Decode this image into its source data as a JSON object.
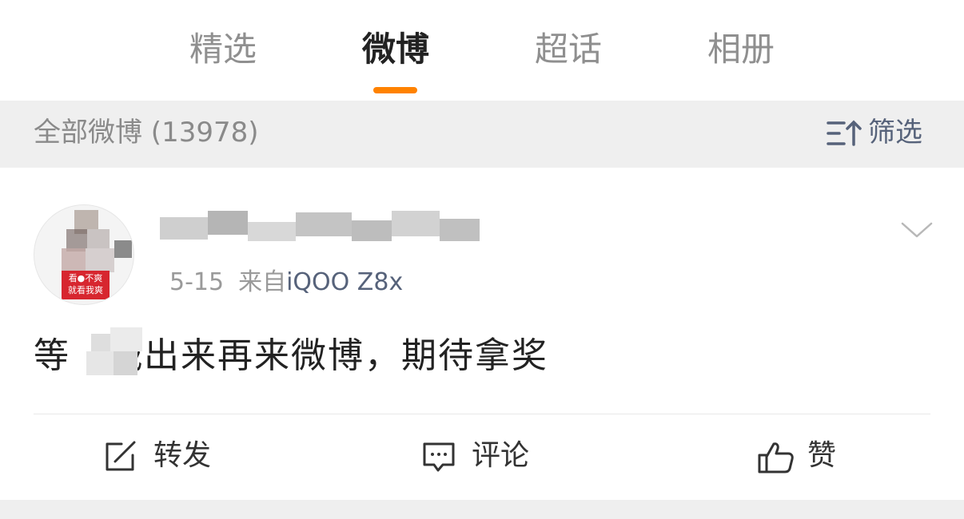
{
  "tabs": [
    {
      "label": "精选",
      "active": false
    },
    {
      "label": "微博",
      "active": true
    },
    {
      "label": "超话",
      "active": false
    },
    {
      "label": "相册",
      "active": false
    }
  ],
  "filter_bar": {
    "title": "全部微博 (13978)",
    "filter_label": "筛选"
  },
  "post": {
    "avatar_badge_text": [
      "看●不爽",
      "就看我爽"
    ],
    "username": "",
    "date": "5-15",
    "from_label": "来自",
    "device": "iQOO Z8x",
    "content": "等　战出来再来微博，期待拿奖",
    "actions": {
      "repost": "转发",
      "comment": "评论",
      "like": "赞"
    }
  },
  "colors": {
    "accent": "#ff8200",
    "link": "#56627a",
    "muted": "#9a9a9a",
    "band": "#efefef"
  }
}
